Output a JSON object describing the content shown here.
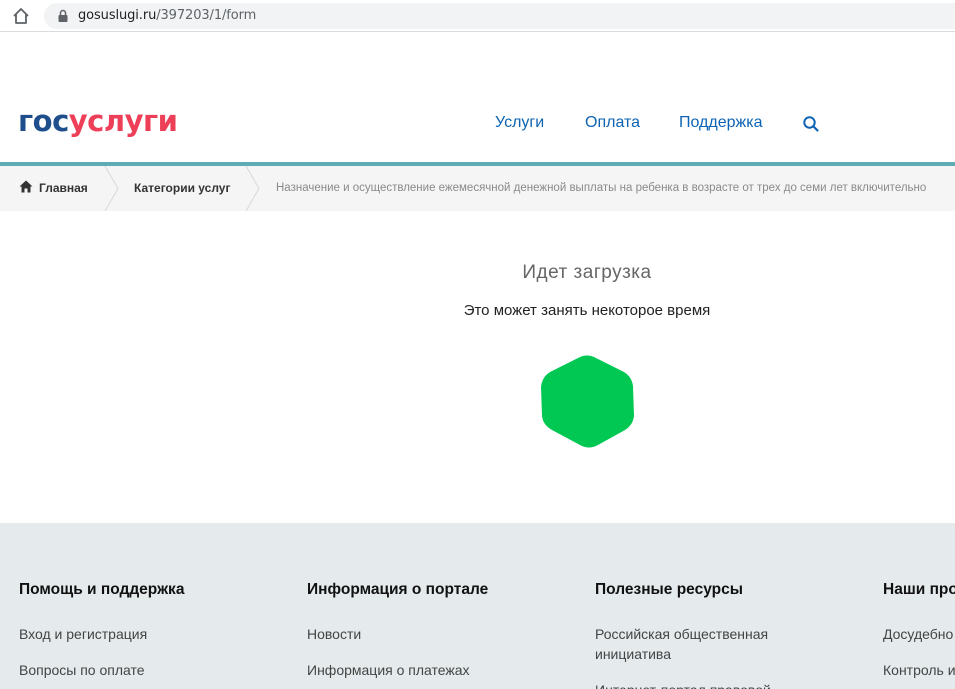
{
  "browser": {
    "url_host": "gosuslugi.ru",
    "url_path": "/397203/1/form"
  },
  "header": {
    "logo_part1": "гос",
    "logo_part2": "услуги",
    "nav": [
      "Услуги",
      "Оплата",
      "Поддержка"
    ]
  },
  "breadcrumb": {
    "home": "Главная",
    "categories": "Категории услуг",
    "current": "Назначение и осуществление ежемесячной денежной выплаты на ребенка в возрасте от трех до семи лет включительно"
  },
  "loader": {
    "title": "Идет загрузка",
    "subtitle": "Это может занять некоторое время"
  },
  "footer": {
    "columns": [
      {
        "title": "Помощь и поддержка",
        "links": [
          "Вход и регистрация",
          "Вопросы по оплате"
        ]
      },
      {
        "title": "Информация о портале",
        "links": [
          "Новости",
          "Информация о платежах"
        ]
      },
      {
        "title": "Полезные ресурсы",
        "links": [
          "Российская общественная",
          "инициатива",
          "Интернет-портал правовой"
        ]
      },
      {
        "title": "Наши про",
        "links": [
          "Досудебно",
          "Контроль и"
        ]
      }
    ]
  },
  "colors": {
    "logo_blue": "#1e4f8c",
    "logo_red": "#ee3f58",
    "nav_link": "#0d64b3",
    "accent_line": "#5fadb4",
    "spinner": "#00c853",
    "footer_bg": "#e5ebec"
  }
}
